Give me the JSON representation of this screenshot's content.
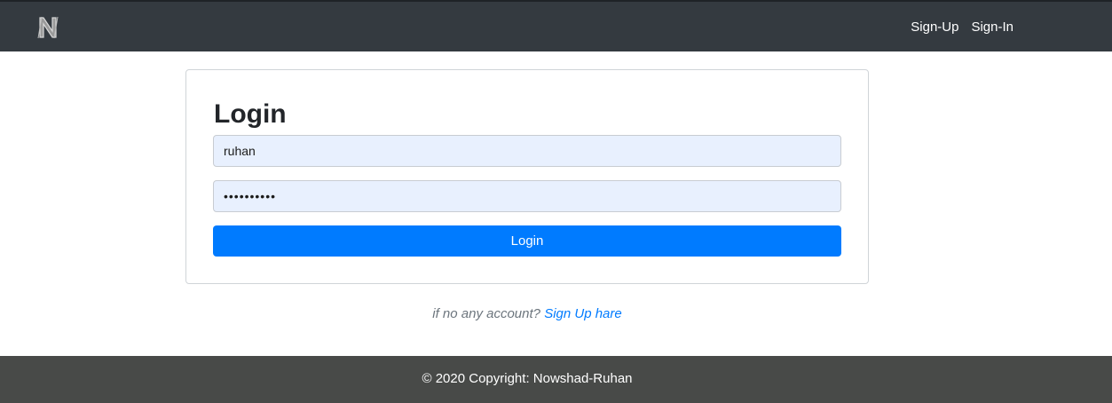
{
  "navbar": {
    "brand_icon": "n-logo-icon",
    "links": [
      "Sign-Up",
      "Sign-In"
    ]
  },
  "login_card": {
    "title": "Login",
    "username_value": "ruhan",
    "password_value": "••••••••••",
    "submit_label": "Login"
  },
  "signup_hint": {
    "prefix": "if no any account?",
    "link_text": "Sign Up hare"
  },
  "footer": {
    "copyright": "© 2020 Copyright: Nowshad-Ruhan"
  },
  "colors": {
    "navbar_bg": "#343a40",
    "primary": "#007bff",
    "autofill_bg": "#e8f0fe",
    "footer_bg": "#484a48"
  }
}
